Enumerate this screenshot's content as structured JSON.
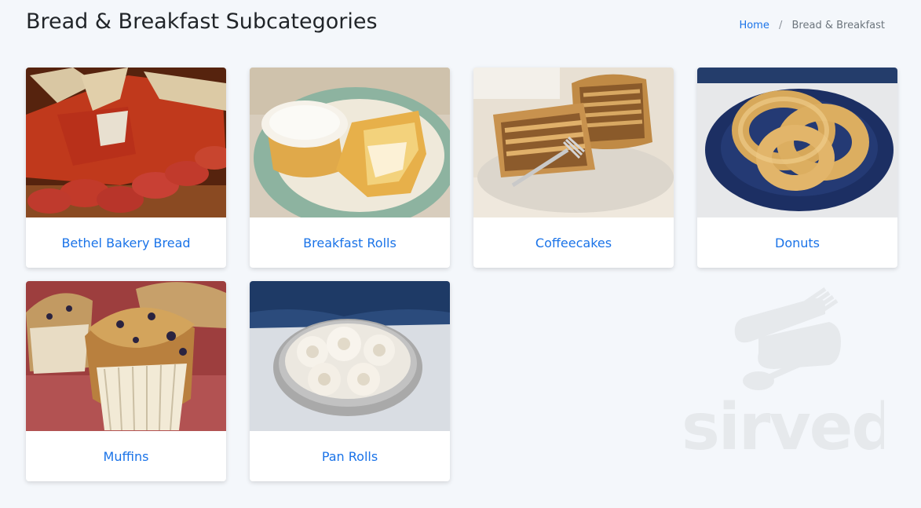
{
  "page": {
    "title": "Bread & Breakfast Subcategories"
  },
  "breadcrumb": {
    "home_label": "Home",
    "separator": "/",
    "current_label": "Bread & Breakfast"
  },
  "subcategories": [
    {
      "label": "Bethel Bakery Bread",
      "image": "pizza-bread-photo"
    },
    {
      "label": "Breakfast Rolls",
      "image": "iced-breakfast-roll-photo"
    },
    {
      "label": "Coffeecakes",
      "image": "coffeecake-photo"
    },
    {
      "label": "Donuts",
      "image": "pretzel-donut-photo"
    },
    {
      "label": "Muffins",
      "image": "blueberry-muffin-photo"
    },
    {
      "label": "Pan Rolls",
      "image": "pan-rolls-photo"
    }
  ],
  "watermark": {
    "brand": "sirved"
  },
  "colors": {
    "link": "#1a73e8",
    "background": "#f4f7fb",
    "card": "#ffffff",
    "title": "#212529",
    "muted": "#6c757d",
    "watermark": "#e6e9ec"
  }
}
